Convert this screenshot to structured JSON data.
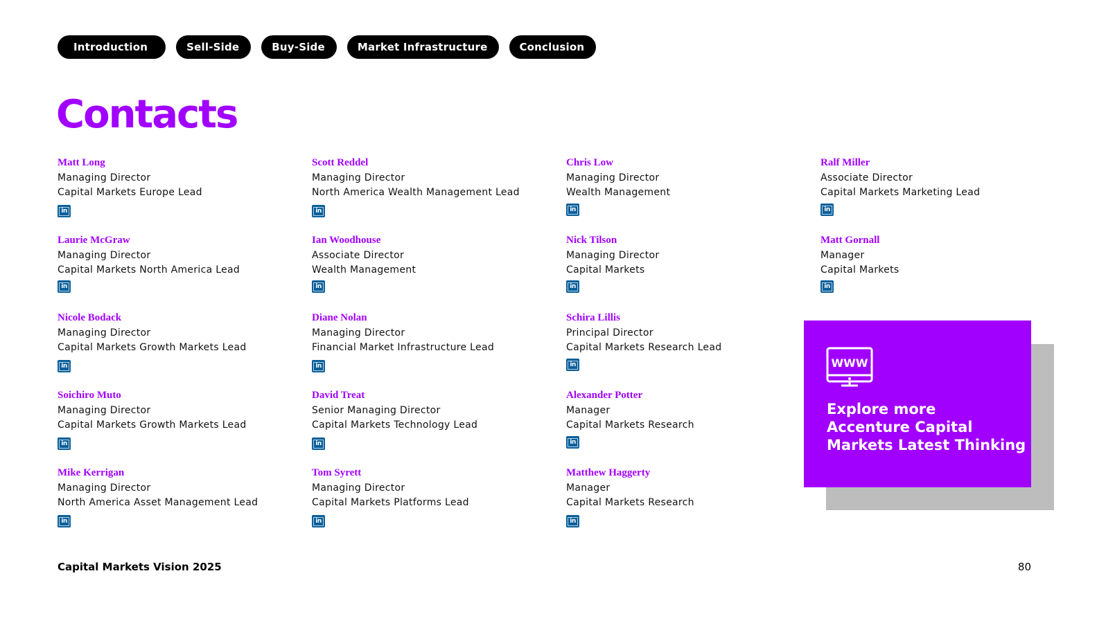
{
  "nav": {
    "tabs": [
      {
        "label": "Introduction"
      },
      {
        "label": "Sell-Side"
      },
      {
        "label": "Buy-Side"
      },
      {
        "label": "Market Infrastructure"
      },
      {
        "label": "Conclusion"
      }
    ]
  },
  "page_title": "Contacts",
  "contacts": [
    {
      "name": "Matt Long",
      "role": "Managing Director",
      "dept": "Capital Markets Europe Lead"
    },
    {
      "name": "Scott Reddel",
      "role": "Managing Director",
      "dept": "North America Wealth Management Lead"
    },
    {
      "name": "Chris Low",
      "role": "Managing Director",
      "dept": "Wealth Management"
    },
    {
      "name": "Ralf Miller",
      "role": "Associate Director",
      "dept": "Capital Markets Marketing Lead"
    },
    {
      "name": "Laurie McGraw",
      "role": "Managing Director",
      "dept": "Capital Markets North America Lead"
    },
    {
      "name": "Ian Woodhouse",
      "role": "Associate Director",
      "dept": "Wealth Management"
    },
    {
      "name": "Nick Tilson",
      "role": "Managing Director",
      "dept": "Capital Markets"
    },
    {
      "name": "Matt Gornall",
      "role": "Manager",
      "dept": "Capital Markets"
    },
    {
      "name": "Nicole Bodack",
      "role": "Managing Director",
      "dept": "Capital Markets Growth Markets Lead"
    },
    {
      "name": "Diane Nolan",
      "role": "Managing Director",
      "dept": "Financial Market Infrastructure Lead"
    },
    {
      "name": "Schira Lillis",
      "role": "Principal Director",
      "dept": "Capital Markets Research Lead"
    },
    {
      "name": "Soichiro Muto",
      "role": "Managing Director",
      "dept": "Capital Markets Growth Markets Lead"
    },
    {
      "name": "David Treat",
      "role": "Senior Managing Director",
      "dept": "Capital Markets Technology Lead"
    },
    {
      "name": "Alexander Potter",
      "role": "Manager",
      "dept": "Capital Markets Research"
    },
    {
      "name": "Mike Kerrigan",
      "role": "Managing Director",
      "dept": "North America Asset Management Lead"
    },
    {
      "name": "Tom Syrett",
      "role": "Managing Director",
      "dept": "Capital Markets Platforms Lead"
    },
    {
      "name": "Matthew Haggerty",
      "role": "Manager",
      "dept": "Capital Markets Research"
    }
  ],
  "linkedin_icon_text": "in",
  "promo": {
    "icon_text": "WWW",
    "text": "Explore more\nAccenture Capital\nMarkets Latest Thinking"
  },
  "footer": {
    "title": "Capital Markets Vision 2025",
    "page_number": "80"
  },
  "colors": {
    "accent": "#a100ff",
    "linkedin": "#0a5f9a",
    "shadow": "#bdbdbd"
  }
}
